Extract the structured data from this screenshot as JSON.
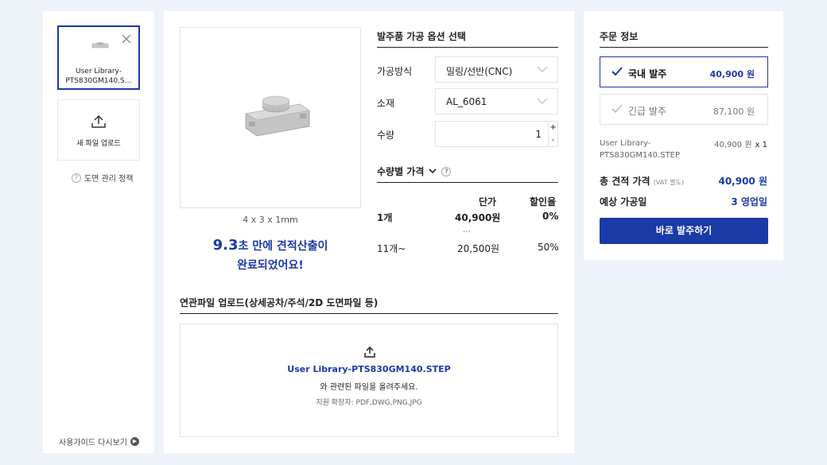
{
  "files": {
    "items": [
      {
        "name_line1": "User Library-",
        "name_line2": "PTS830GM140.S…"
      }
    ],
    "upload_label": "새 파일 업로드",
    "policy_label": "도면 관리 정책",
    "guide_label": "사용가이드 다시보기"
  },
  "preview": {
    "dimensions": "4 x 3 x 1mm",
    "done_seconds": "9.3",
    "done_line1_rest": "초 만에 견적산출이",
    "done_line2": "완료되었어요!"
  },
  "options": {
    "title": "발주품 가공 옵션 선택",
    "method_label": "가공방식",
    "method_value": "밀링/선반(CNC)",
    "material_label": "소재",
    "material_value": "AL_6061",
    "qty_label": "수량",
    "qty_value": "1",
    "plus": "+",
    "minus": "-"
  },
  "pricing": {
    "title": "수량별 가격",
    "help_symbol": "?",
    "headers": {
      "unit": "단가",
      "discount": "할인율"
    },
    "rows": [
      {
        "qty": "1개",
        "unit": "40,900원",
        "discount": "0%"
      },
      {
        "qty": "11개~",
        "unit": "20,500원",
        "discount": "50%"
      }
    ],
    "ellipsis": "..."
  },
  "related": {
    "title": "연관파일 업로드(상세공차/주석/2D 도면파일 등)",
    "file_name": "User Library-PTS830GM140.STEP",
    "message": "와 관련된 파일을 올려주세요.",
    "extensions": "지원 확장자: PDF,DWG,PNG,JPG"
  },
  "order": {
    "title": "주문 정보",
    "options": [
      {
        "name": "국내 발주",
        "price": "40,900 원",
        "active": true
      },
      {
        "name": "긴급 발주",
        "price": "87,100 원",
        "active": false
      }
    ],
    "summary_file_line1": "User Library-",
    "summary_file_line2": "PTS830GM140.STEP",
    "summary_price": "40,900 원",
    "summary_qty": "x 1",
    "total_label": "총 견적 가격",
    "total_note": "(VAT 별도)",
    "total_value": "40,900 원",
    "eta_label": "예상 가공일",
    "eta_value": "3 영업일",
    "button_label": "바로 발주하기"
  },
  "colors": {
    "accent": "#1a3aa5",
    "background": "#eef2f9"
  }
}
